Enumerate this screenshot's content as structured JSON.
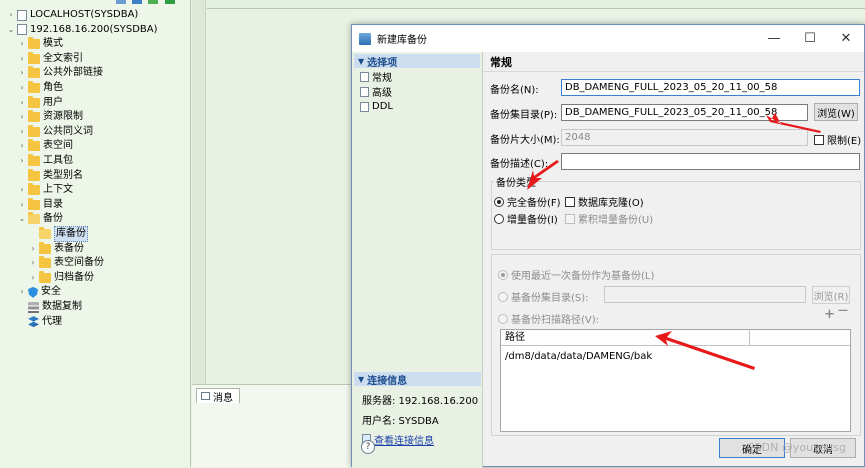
{
  "tree": {
    "nodes": [
      {
        "label": "LOCALHOST(SYSDBA)",
        "arrow": "›",
        "icon": "database-icon",
        "depth": 0
      },
      {
        "label": "192.168.16.200(SYSDBA)",
        "arrow": "⌄",
        "icon": "database-icon",
        "depth": 0
      },
      {
        "label": "模式",
        "arrow": "›",
        "icon": "folder-icon",
        "depth": 1
      },
      {
        "label": "全文索引",
        "arrow": "›",
        "icon": "folder-icon",
        "depth": 1
      },
      {
        "label": "公共外部链接",
        "arrow": "›",
        "icon": "folder-icon",
        "depth": 1
      },
      {
        "label": "角色",
        "arrow": "›",
        "icon": "folder-icon",
        "depth": 1
      },
      {
        "label": "用户",
        "arrow": "›",
        "icon": "folder-icon",
        "depth": 1
      },
      {
        "label": "资源限制",
        "arrow": "›",
        "icon": "folder-icon",
        "depth": 1
      },
      {
        "label": "公共同义词",
        "arrow": "›",
        "icon": "folder-icon",
        "depth": 1
      },
      {
        "label": "表空间",
        "arrow": "›",
        "icon": "folder-icon",
        "depth": 1
      },
      {
        "label": "工具包",
        "arrow": "›",
        "icon": "folder-icon",
        "depth": 1
      },
      {
        "label": "类型别名",
        "arrow": "",
        "icon": "folder-icon",
        "depth": 1
      },
      {
        "label": "上下文",
        "arrow": "›",
        "icon": "folder-icon",
        "depth": 1
      },
      {
        "label": "目录",
        "arrow": "›",
        "icon": "folder-icon",
        "depth": 1
      },
      {
        "label": "备份",
        "arrow": "⌄",
        "icon": "folder-open-icon",
        "depth": 1
      },
      {
        "label": "库备份",
        "arrow": "",
        "icon": "folder-open-icon",
        "depth": 2,
        "selected": true
      },
      {
        "label": "表备份",
        "arrow": "›",
        "icon": "folder-icon",
        "depth": 2
      },
      {
        "label": "表空间备份",
        "arrow": "›",
        "icon": "folder-icon",
        "depth": 2
      },
      {
        "label": "归档备份",
        "arrow": "›",
        "icon": "folder-icon",
        "depth": 2
      },
      {
        "label": "安全",
        "arrow": "›",
        "icon": "shield-icon",
        "depth": 1
      },
      {
        "label": "数据复制",
        "arrow": "",
        "icon": "replication-icon",
        "depth": 1
      },
      {
        "label": "代理",
        "arrow": "",
        "icon": "agent-icon",
        "depth": 1
      }
    ]
  },
  "messages": {
    "tab_label": "消息"
  },
  "dialog": {
    "title": "新建库备份",
    "minimize": "—",
    "maximize": "☐",
    "close": "✕",
    "nav": {
      "header": "选择项",
      "items": [
        "常规",
        "高级",
        "DDL"
      ]
    },
    "connection": {
      "header": "连接信息",
      "server": "服务器: 192.168.16.200",
      "user": "用户名: SYSDBA",
      "view_link": "查看连接信息"
    },
    "help": "?",
    "section_title": "常规",
    "backup_name_label": "备份名(N):",
    "backup_name_value": "DB_DAMENG_FULL_2023_05_20_11_00_58",
    "backup_dir_label": "备份集目录(P):",
    "backup_dir_value": "DB_DAMENG_FULL_2023_05_20_11_00_58",
    "browse_label": "浏览(W)",
    "piece_size_label": "备份片大小(M):",
    "piece_size_value": "2048",
    "limit_label": "限制(E)",
    "desc_label": "备份描述(C):",
    "desc_value": "",
    "type_group_label": "备份类型",
    "full_backup_label": "完全备份(F)",
    "db_clone_label": "数据库克隆(O)",
    "incr_backup_label": "增量备份(I)",
    "cumulative_label": "累积增量备份(U)",
    "use_latest_label": "使用最近一次备份作为基备份(L)",
    "base_dir_label": "基备份集目录(S):",
    "base_dir_value": "",
    "browse2_label": "浏览(R)",
    "scan_path_label": "基备份扫描路径(V):",
    "plus": "+",
    "minus": "—",
    "path_header": "路径",
    "paths": [
      "/dm8/data/data/DAMENG/bak"
    ],
    "ok_label": "确定",
    "cancel_label": "取消"
  },
  "watermark": "CSDN @youyousg",
  "colors": {
    "accent_arrow": "#e8191b",
    "nav_header": "#cdddf0",
    "tree_bg": "#eef6ea"
  }
}
